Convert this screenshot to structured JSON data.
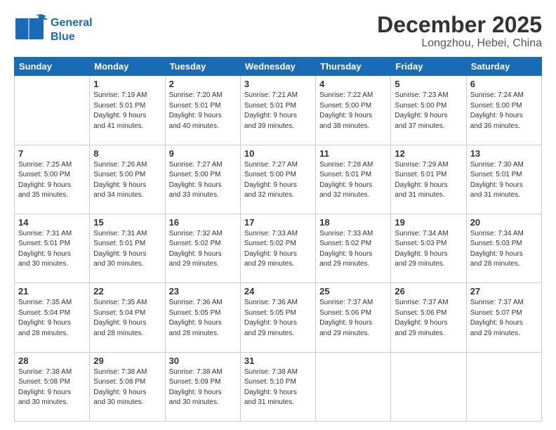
{
  "header": {
    "logo_line1": "General",
    "logo_line2": "Blue",
    "title": "December 2025",
    "subtitle": "Longzhou, Hebei, China"
  },
  "weekdays": [
    "Sunday",
    "Monday",
    "Tuesday",
    "Wednesday",
    "Thursday",
    "Friday",
    "Saturday"
  ],
  "weeks": [
    [
      {
        "day": "",
        "info": ""
      },
      {
        "day": "1",
        "info": "Sunrise: 7:19 AM\nSunset: 5:01 PM\nDaylight: 9 hours\nand 41 minutes."
      },
      {
        "day": "2",
        "info": "Sunrise: 7:20 AM\nSunset: 5:01 PM\nDaylight: 9 hours\nand 40 minutes."
      },
      {
        "day": "3",
        "info": "Sunrise: 7:21 AM\nSunset: 5:01 PM\nDaylight: 9 hours\nand 39 minutes."
      },
      {
        "day": "4",
        "info": "Sunrise: 7:22 AM\nSunset: 5:00 PM\nDaylight: 9 hours\nand 38 minutes."
      },
      {
        "day": "5",
        "info": "Sunrise: 7:23 AM\nSunset: 5:00 PM\nDaylight: 9 hours\nand 37 minutes."
      },
      {
        "day": "6",
        "info": "Sunrise: 7:24 AM\nSunset: 5:00 PM\nDaylight: 9 hours\nand 36 minutes."
      }
    ],
    [
      {
        "day": "7",
        "info": "Sunrise: 7:25 AM\nSunset: 5:00 PM\nDaylight: 9 hours\nand 35 minutes."
      },
      {
        "day": "8",
        "info": "Sunrise: 7:26 AM\nSunset: 5:00 PM\nDaylight: 9 hours\nand 34 minutes."
      },
      {
        "day": "9",
        "info": "Sunrise: 7:27 AM\nSunset: 5:00 PM\nDaylight: 9 hours\nand 33 minutes."
      },
      {
        "day": "10",
        "info": "Sunrise: 7:27 AM\nSunset: 5:00 PM\nDaylight: 9 hours\nand 32 minutes."
      },
      {
        "day": "11",
        "info": "Sunrise: 7:28 AM\nSunset: 5:01 PM\nDaylight: 9 hours\nand 32 minutes."
      },
      {
        "day": "12",
        "info": "Sunrise: 7:29 AM\nSunset: 5:01 PM\nDaylight: 9 hours\nand 31 minutes."
      },
      {
        "day": "13",
        "info": "Sunrise: 7:30 AM\nSunset: 5:01 PM\nDaylight: 9 hours\nand 31 minutes."
      }
    ],
    [
      {
        "day": "14",
        "info": "Sunrise: 7:31 AM\nSunset: 5:01 PM\nDaylight: 9 hours\nand 30 minutes."
      },
      {
        "day": "15",
        "info": "Sunrise: 7:31 AM\nSunset: 5:01 PM\nDaylight: 9 hours\nand 30 minutes."
      },
      {
        "day": "16",
        "info": "Sunrise: 7:32 AM\nSunset: 5:02 PM\nDaylight: 9 hours\nand 29 minutes."
      },
      {
        "day": "17",
        "info": "Sunrise: 7:33 AM\nSunset: 5:02 PM\nDaylight: 9 hours\nand 29 minutes."
      },
      {
        "day": "18",
        "info": "Sunrise: 7:33 AM\nSunset: 5:02 PM\nDaylight: 9 hours\nand 29 minutes."
      },
      {
        "day": "19",
        "info": "Sunrise: 7:34 AM\nSunset: 5:03 PM\nDaylight: 9 hours\nand 29 minutes."
      },
      {
        "day": "20",
        "info": "Sunrise: 7:34 AM\nSunset: 5:03 PM\nDaylight: 9 hours\nand 28 minutes."
      }
    ],
    [
      {
        "day": "21",
        "info": "Sunrise: 7:35 AM\nSunset: 5:04 PM\nDaylight: 9 hours\nand 28 minutes."
      },
      {
        "day": "22",
        "info": "Sunrise: 7:35 AM\nSunset: 5:04 PM\nDaylight: 9 hours\nand 28 minutes."
      },
      {
        "day": "23",
        "info": "Sunrise: 7:36 AM\nSunset: 5:05 PM\nDaylight: 9 hours\nand 28 minutes."
      },
      {
        "day": "24",
        "info": "Sunrise: 7:36 AM\nSunset: 5:05 PM\nDaylight: 9 hours\nand 29 minutes."
      },
      {
        "day": "25",
        "info": "Sunrise: 7:37 AM\nSunset: 5:06 PM\nDaylight: 9 hours\nand 29 minutes."
      },
      {
        "day": "26",
        "info": "Sunrise: 7:37 AM\nSunset: 5:06 PM\nDaylight: 9 hours\nand 29 minutes."
      },
      {
        "day": "27",
        "info": "Sunrise: 7:37 AM\nSunset: 5:07 PM\nDaylight: 9 hours\nand 29 minutes."
      }
    ],
    [
      {
        "day": "28",
        "info": "Sunrise: 7:38 AM\nSunset: 5:08 PM\nDaylight: 9 hours\nand 30 minutes."
      },
      {
        "day": "29",
        "info": "Sunrise: 7:38 AM\nSunset: 5:08 PM\nDaylight: 9 hours\nand 30 minutes."
      },
      {
        "day": "30",
        "info": "Sunrise: 7:38 AM\nSunset: 5:09 PM\nDaylight: 9 hours\nand 30 minutes."
      },
      {
        "day": "31",
        "info": "Sunrise: 7:38 AM\nSunset: 5:10 PM\nDaylight: 9 hours\nand 31 minutes."
      },
      {
        "day": "",
        "info": ""
      },
      {
        "day": "",
        "info": ""
      },
      {
        "day": "",
        "info": ""
      }
    ]
  ]
}
